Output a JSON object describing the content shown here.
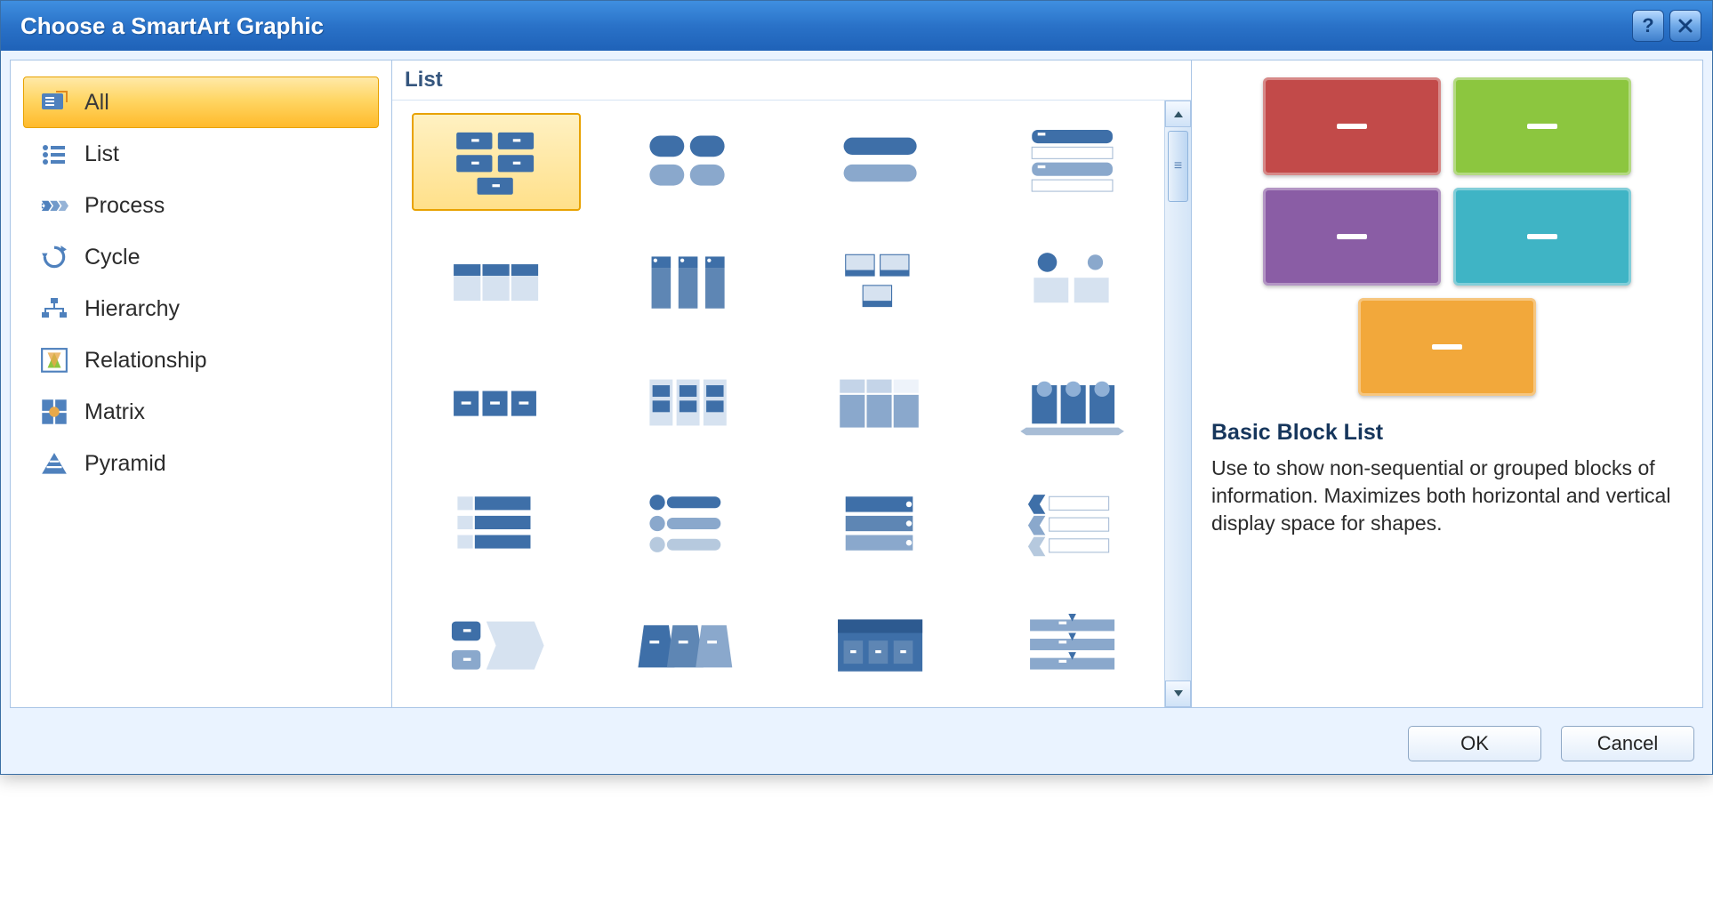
{
  "dialog": {
    "title": "Choose a SmartArt Graphic"
  },
  "sidebar": {
    "items": [
      {
        "label": "All",
        "selected": true
      },
      {
        "label": "List",
        "selected": false
      },
      {
        "label": "Process",
        "selected": false
      },
      {
        "label": "Cycle",
        "selected": false
      },
      {
        "label": "Hierarchy",
        "selected": false
      },
      {
        "label": "Relationship",
        "selected": false
      },
      {
        "label": "Matrix",
        "selected": false
      },
      {
        "label": "Pyramid",
        "selected": false
      }
    ]
  },
  "gallery": {
    "header": "List",
    "selected_index": 0,
    "thumb_count": 20
  },
  "preview": {
    "title": "Basic Block List",
    "description": "Use to show non-sequential or grouped blocks of information. Maximizes both horizontal and vertical display space for shapes.",
    "blocks": [
      {
        "color": "#c24a49"
      },
      {
        "color": "#8cc63f"
      },
      {
        "color": "#8a5da5"
      },
      {
        "color": "#3fb4c5"
      },
      {
        "color": "#f2a83b"
      }
    ]
  },
  "buttons": {
    "ok": "OK",
    "cancel": "Cancel"
  }
}
